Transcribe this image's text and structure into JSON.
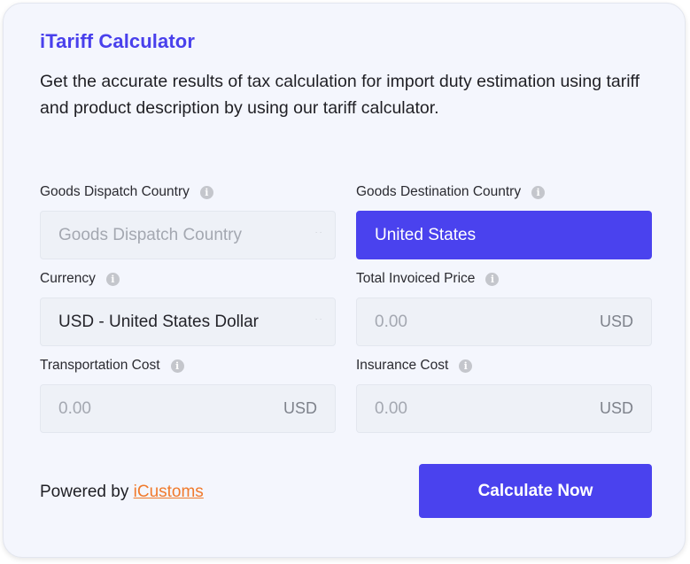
{
  "calculator": {
    "title": "iTariff Calculator",
    "description": "Get the accurate results of tax calculation for import duty estimation using tariff and product description by using our tariff calculator."
  },
  "fields": {
    "dispatch_country": {
      "label": "Goods Dispatch Country",
      "placeholder": "Goods Dispatch Country",
      "value": ""
    },
    "destination_country": {
      "label": "Goods Destination Country",
      "value": "United States"
    },
    "currency": {
      "label": "Currency",
      "value": "USD - United States Dollar"
    },
    "total_invoiced_price": {
      "label": "Total Invoiced Price",
      "placeholder": "0.00",
      "suffix": "USD"
    },
    "transportation_cost": {
      "label": "Transportation Cost",
      "placeholder": "0.00",
      "suffix": "USD"
    },
    "insurance_cost": {
      "label": "Insurance Cost",
      "placeholder": "0.00",
      "suffix": "USD"
    }
  },
  "footer": {
    "powered_by_prefix": "Powered by",
    "powered_by_link": "iCustoms",
    "calculate_label": "Calculate Now"
  },
  "icons": {
    "info": "i",
    "dropdown": "˙˙"
  },
  "colors": {
    "accent": "#4a42ee",
    "title": "#4940ec",
    "link": "#f07a2c",
    "card_background": "#f4f6fd",
    "field_background": "#eef1f7"
  }
}
